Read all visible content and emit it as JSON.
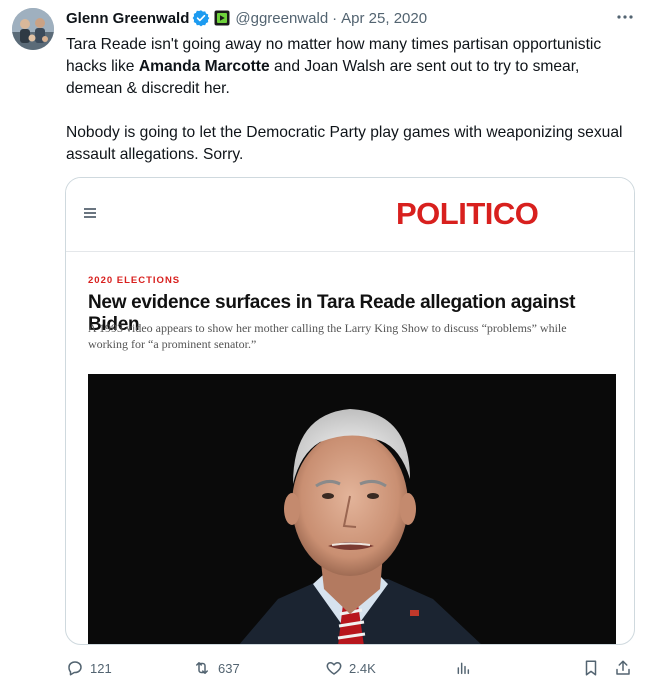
{
  "author": {
    "name": "Glenn Greenwald",
    "handle": "@ggreenwald",
    "separator": "·",
    "date": "Apr 25, 2020"
  },
  "tweet": {
    "text_part1": "Tara Reade isn't going away no matter how many times partisan opportunistic hacks like ",
    "mention_bold": "Amanda Marcotte",
    "text_part2": " and Joan Walsh are sent out to try to smear, demean & discredit her.\n\nNobody is going to let the Democratic Party play games with weaponizing sexual assault allegations. Sorry."
  },
  "card": {
    "logo": "POLITICO",
    "kicker": "2020 ELECTIONS",
    "headline": "New evidence surfaces in Tara Reade allegation against Biden",
    "dek": "A 1993 video appears to show her mother calling the Larry King Show to discuss “problems” while working for “a prominent senator.”"
  },
  "actions": {
    "replies": "121",
    "reposts": "637",
    "likes": "2.4K"
  },
  "colors": {
    "verified": "#1d9bf0",
    "politico_red": "#d8201e",
    "muted": "#536471"
  }
}
